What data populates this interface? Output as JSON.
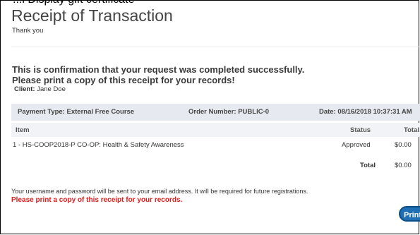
{
  "header": {
    "top_clip": "...l Display gift certificate",
    "title": "Receipt of Transaction",
    "subtitle": "Thank you"
  },
  "messages": {
    "confirmation": "This is confirmation that your request was completed successfully.",
    "print_instruction": "Please print a copy of this receipt for your records!",
    "client_label": "Client:",
    "client_name": "Jane Doe"
  },
  "summary_bar": {
    "payment_type": "Payment Type: External Free Course",
    "order_number": "Order Number: PUBLIC-0",
    "date": "Date: 08/16/2018 10:37:31 AM"
  },
  "table": {
    "headers": {
      "item": "Item",
      "status": "Status",
      "total": "Total"
    },
    "rows": [
      {
        "item": "1 - HS-COOP2018-P CO-OP: Health & Safety Awareness",
        "status": "Approved",
        "total": "$0.00"
      }
    ],
    "total_label": "Total",
    "total_value": "$0.00"
  },
  "footer": {
    "credentials_note": "Your username and password will be sent to your email address. It will be required for future registrations.",
    "print_warning": "Please print a copy of this receipt for your records."
  },
  "actions": {
    "print_label": "Print"
  },
  "colors": {
    "warning": "#e21b1b",
    "button": "#1f6fb2",
    "bar_bg": "#e6e9ef"
  }
}
